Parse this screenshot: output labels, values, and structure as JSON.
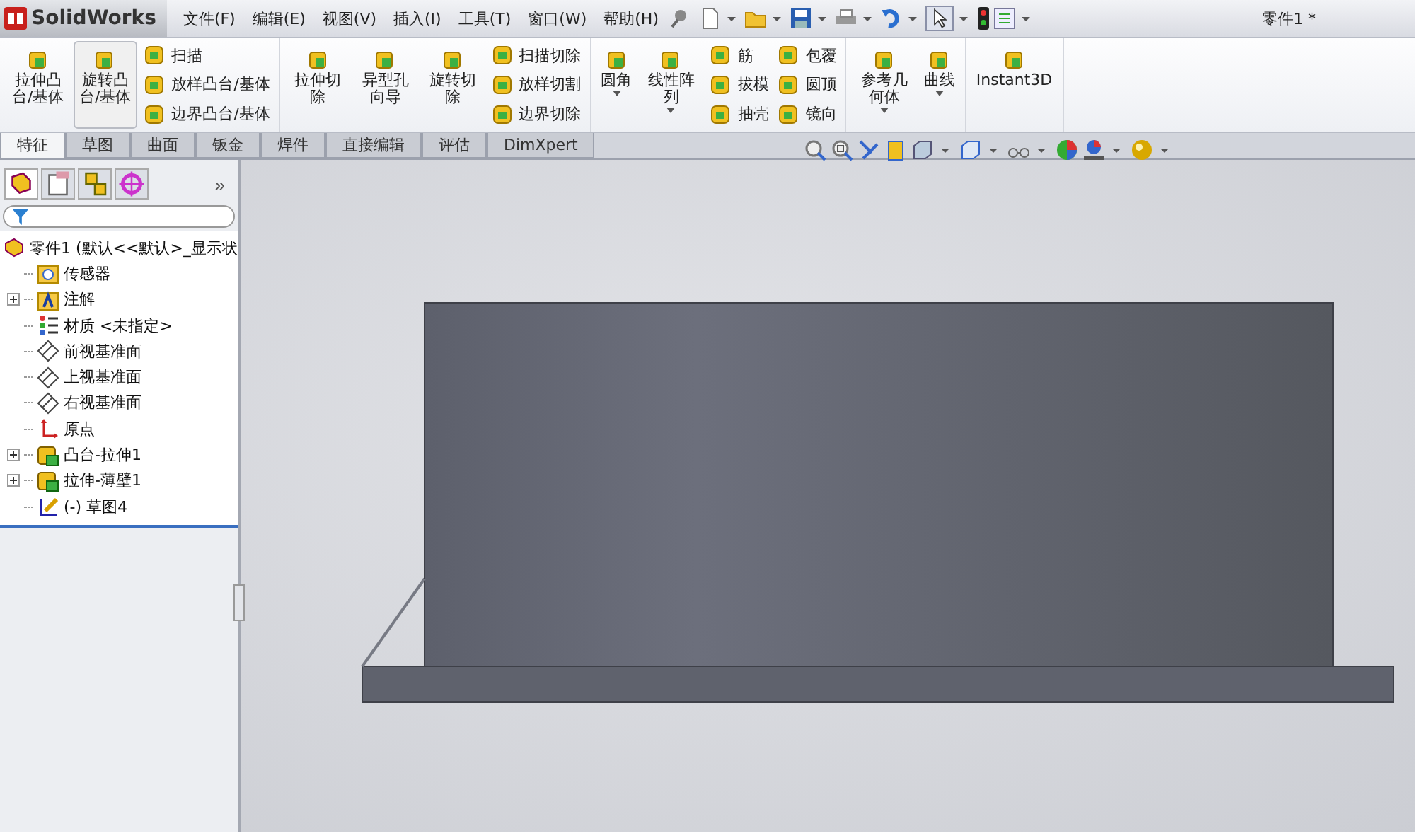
{
  "app": {
    "logo_text": "SolidWorks",
    "title": "零件1 *"
  },
  "menu": [
    "文件(F)",
    "编辑(E)",
    "视图(V)",
    "插入(I)",
    "工具(T)",
    "窗口(W)",
    "帮助(H)"
  ],
  "ribbon": [
    {
      "items": [
        {
          "kind": "large",
          "label": "拉伸凸台/基体",
          "selected": false,
          "dropdown": false
        },
        {
          "kind": "large",
          "label": "旋转凸台/基体",
          "selected": true,
          "dropdown": false
        },
        {
          "kind": "stack",
          "entries": [
            "扫描",
            "放样凸台/基体",
            "边界凸台/基体"
          ]
        }
      ]
    },
    {
      "items": [
        {
          "kind": "large",
          "label": "拉伸切除",
          "selected": false,
          "dropdown": false
        },
        {
          "kind": "large",
          "label": "异型孔向导",
          "selected": false,
          "dropdown": false
        },
        {
          "kind": "large",
          "label": "旋转切除",
          "selected": false,
          "dropdown": false
        },
        {
          "kind": "stack",
          "entries": [
            "扫描切除",
            "放样切割",
            "边界切除"
          ]
        }
      ]
    },
    {
      "items": [
        {
          "kind": "large",
          "label": "圆角",
          "selected": false,
          "dropdown": true
        },
        {
          "kind": "large",
          "label": "线性阵列",
          "selected": false,
          "dropdown": true
        },
        {
          "kind": "stack",
          "entries": [
            "筋",
            "拔模",
            "抽壳"
          ]
        },
        {
          "kind": "stack",
          "entries": [
            "包覆",
            "圆顶",
            "镜向"
          ]
        }
      ]
    },
    {
      "items": [
        {
          "kind": "large",
          "label": "参考几何体",
          "selected": false,
          "dropdown": true
        },
        {
          "kind": "large",
          "label": "曲线",
          "selected": false,
          "dropdown": true
        }
      ]
    },
    {
      "items": [
        {
          "kind": "large",
          "label": "Instant3D",
          "selected": false,
          "dropdown": false
        }
      ]
    }
  ],
  "tabs": [
    {
      "label": "特征",
      "selected": true
    },
    {
      "label": "草图",
      "selected": false
    },
    {
      "label": "曲面",
      "selected": false
    },
    {
      "label": "钣金",
      "selected": false
    },
    {
      "label": "焊件",
      "selected": false
    },
    {
      "label": "直接编辑",
      "selected": false
    },
    {
      "label": "评估",
      "selected": false
    },
    {
      "label": "DimXpert",
      "selected": false
    }
  ],
  "panel": {
    "more": "»",
    "root": "零件1  (默认<<默认>_显示状",
    "items": [
      {
        "kind": "sensor",
        "label": "传感器"
      },
      {
        "kind": "annotation",
        "label": "注解",
        "expanded": false
      },
      {
        "kind": "material",
        "label": "材质 <未指定>"
      },
      {
        "kind": "plane",
        "label": "前视基准面"
      },
      {
        "kind": "plane",
        "label": "上视基准面"
      },
      {
        "kind": "plane",
        "label": "右视基准面"
      },
      {
        "kind": "origin",
        "label": "原点"
      },
      {
        "kind": "feature",
        "label": "凸台-拉伸1",
        "expanded": false
      },
      {
        "kind": "feature",
        "label": "拉伸-薄壁1",
        "expanded": false
      },
      {
        "kind": "sketch",
        "label": "(-) 草图4"
      }
    ]
  }
}
